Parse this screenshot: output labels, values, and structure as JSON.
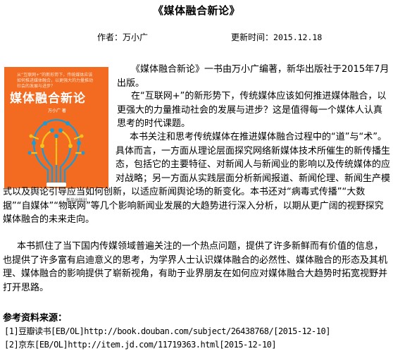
{
  "article": {
    "title": "《媒体融合新论》",
    "author_label": "作者：",
    "author": "万小广",
    "date_label": "更新时间：",
    "date": "2015.12.18"
  },
  "cover": {
    "blurb": "从“互联网+”的新形势下，传统媒体应该如何推进媒体融合，以更强大的力量推动社会的发展与进步？",
    "title": "媒体融合新论",
    "author": "万小广 著",
    "publisher": "新华出版社",
    "colors": {
      "background": "#f26b21",
      "accent_blue": "#1a9ad6",
      "accent_yellow": "#f5c31c"
    }
  },
  "paragraphs": [
    "《媒体融合新论》一书由万小广编著，新华出版社于2015年7月出版。",
    "在“互联网+”的新形势下，传统媒体应该如何推进媒体融合，以更强大的力量推动社会的发展与进步？这是值得每一个媒体人认真思考的时代课题。",
    "本书关注和思考传统媒体在推进媒体融合过程中的“道”与“术”。具体而言，一方面从理论层面探究网络新媒体技术所催生的新传播生态，包括它的主要特征、对新闻人与新闻业的影响以及传统媒体的应对战略；另一方面从实践层面分析新闻报道、新闻伦理、新闻生产模式以及舆论引导应当如何创新，以适应新闻舆论场的新变化。本书还对“病毒式传播”“大数据”“自媒体”“物联网”等几个影响新闻业发展的大趋势进行深入分析，以期从更广阔的视野探究媒体融合的未来走向。",
    "本书抓住了当下国内传媒领域普遍关注的一个热点问题，提供了许多新鲜而有价值的信息，也提供了许多富有启迪意义的思考，为学界人士认识媒体融合的必然性、媒体融合的形态及其机理、媒体融合的影响提供了崭新视角，有助于业界朋友在如何应对媒体融合大趋势时拓宽视野并打开思路。"
  ],
  "references": {
    "title": "参考资料来源：",
    "items": [
      "[1]豆瓣读书[EB/OL]http://book.douban.com/subject/26438768/[2015-12-10]",
      "[2]京东[EB/OL]http://item.jd.com/11719363.html[2015-12-10]"
    ]
  }
}
